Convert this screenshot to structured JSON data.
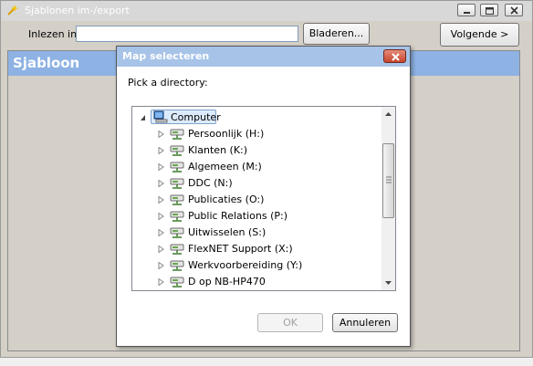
{
  "main_window": {
    "title": "Sjablonen im-/export",
    "toolbar": {
      "import_label": "Inlezen in:",
      "path_value": "",
      "browse_label": "Bladeren...",
      "next_label": "Volgende >"
    },
    "template_panel": {
      "title": "Sjabloon"
    }
  },
  "dialog": {
    "title": "Map selecteren",
    "prompt": "Pick a directory:",
    "tree": {
      "root": {
        "label": "Computer",
        "icon": "computer-icon"
      },
      "items": [
        {
          "label": "Persoonlijk (H:)",
          "icon": "network-drive-icon"
        },
        {
          "label": "Klanten (K:)",
          "icon": "network-drive-icon"
        },
        {
          "label": "Algemeen (M:)",
          "icon": "network-drive-icon"
        },
        {
          "label": "DDC (N:)",
          "icon": "network-drive-icon"
        },
        {
          "label": "Publicaties (O:)",
          "icon": "network-drive-icon"
        },
        {
          "label": "Public Relations (P:)",
          "icon": "network-drive-icon"
        },
        {
          "label": "Uitwisselen (S:)",
          "icon": "network-drive-icon"
        },
        {
          "label": "FlexNET Support (X:)",
          "icon": "network-drive-icon"
        },
        {
          "label": "Werkvoorbereiding (Y:)",
          "icon": "network-drive-icon"
        },
        {
          "label": "D op NB-HP470",
          "icon": "network-drive-icon"
        }
      ]
    },
    "ok_label": "OK",
    "cancel_label": "Annuleren"
  },
  "colors": {
    "panel_header": "#8db2e3",
    "dialog_titlebar": "#a7c3e8",
    "close_button": "#c8452c"
  }
}
